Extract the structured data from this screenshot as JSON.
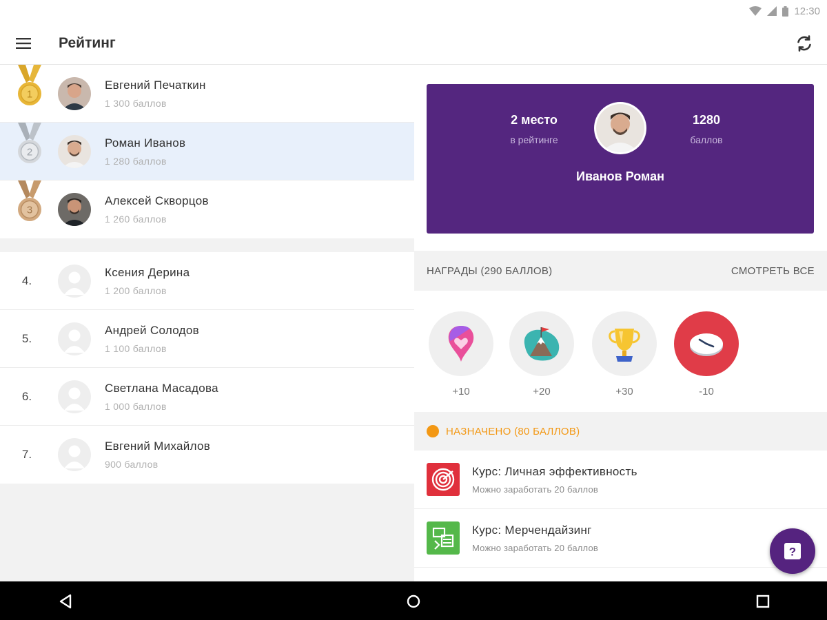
{
  "status_bar": {
    "time": "12:30",
    "icons": [
      "wifi-icon",
      "signal-icon",
      "battery-icon"
    ]
  },
  "app_bar": {
    "title": "Рейтинг",
    "menu_icon": "menu-icon",
    "refresh_icon": "refresh-icon"
  },
  "leaderboard": {
    "top": [
      {
        "rank": "1",
        "name": "Евгений Печаткин",
        "points": "1 300 баллов",
        "medal": "gold",
        "selected": false
      },
      {
        "rank": "2",
        "name": "Роман Иванов",
        "points": "1 280 баллов",
        "medal": "silver",
        "selected": true
      },
      {
        "rank": "3",
        "name": "Алексей Скворцов",
        "points": "1 260 баллов",
        "medal": "bronze",
        "selected": false
      }
    ],
    "others": [
      {
        "rank": "4.",
        "name": "Ксения Дерина",
        "points": "1 200 баллов"
      },
      {
        "rank": "5.",
        "name": "Андрей Солодов",
        "points": "1 100 баллов"
      },
      {
        "rank": "6.",
        "name": "Светлана Масадова",
        "points": "1 000 баллов"
      },
      {
        "rank": "7.",
        "name": "Евгений Михайлов",
        "points": "900 баллов"
      }
    ]
  },
  "profile": {
    "place_value": "2 место",
    "place_label": "в рейтинге",
    "points_value": "1280",
    "points_label": "баллов",
    "name": "Иванов Роман"
  },
  "awards": {
    "title": "НАГРАДЫ (290 БАЛЛОВ)",
    "see_all": "СМОТРЕТЬ ВСЕ",
    "items": [
      {
        "icon": "heart-pin-icon",
        "value": "+10"
      },
      {
        "icon": "mountain-flag-icon",
        "value": "+20"
      },
      {
        "icon": "trophy-icon",
        "value": "+30"
      },
      {
        "icon": "clock-icon",
        "value": "-10"
      }
    ]
  },
  "assigned": {
    "title": "НАЗНАЧЕНО (80 БАЛЛОВ)",
    "courses": [
      {
        "title": "Курс: Личная эффективность",
        "subtitle": "Можно заработать 20 баллов",
        "icon": "target-icon"
      },
      {
        "title": "Курс: Мерчендайзинг",
        "subtitle": "Можно заработать 20 баллов",
        "icon": "merchandising-icon"
      }
    ]
  },
  "fab": {
    "icon": "help-icon",
    "label": "?"
  },
  "colors": {
    "purple": "#54267f",
    "orange": "#f39814",
    "selected_row": "#e8f0fb"
  }
}
